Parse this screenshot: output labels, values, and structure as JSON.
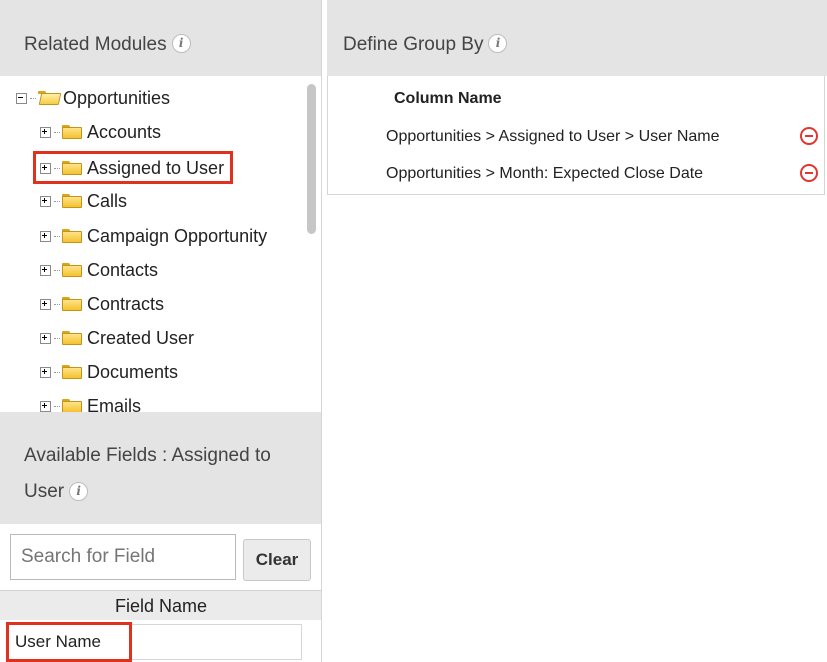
{
  "related_modules": {
    "title": "Related Modules",
    "info_icon": "i",
    "root": "Opportunities",
    "items": [
      "Accounts",
      "Assigned to User",
      "Calls",
      "Campaign Opportunity",
      "Contacts",
      "Contracts",
      "Created User",
      "Documents",
      "Emails"
    ],
    "highlighted_item": "Assigned to User"
  },
  "available_fields": {
    "title_line1": "Available Fields : Assigned to",
    "title_line2": "User",
    "info_icon": "i",
    "search_placeholder": "Search for Field",
    "clear_label": "Clear",
    "column_header": "Field Name",
    "rows": [
      "User Name"
    ]
  },
  "define_group_by": {
    "title": "Define Group By",
    "info_icon": "i",
    "column_header": "Column Name",
    "rows": [
      "Opportunities > Assigned to User > User Name",
      "Opportunities > Month: Expected Close Date"
    ]
  },
  "colors": {
    "highlight": "#e0301e",
    "remove": "#e2352f",
    "header_bg": "#e4e4e4"
  }
}
